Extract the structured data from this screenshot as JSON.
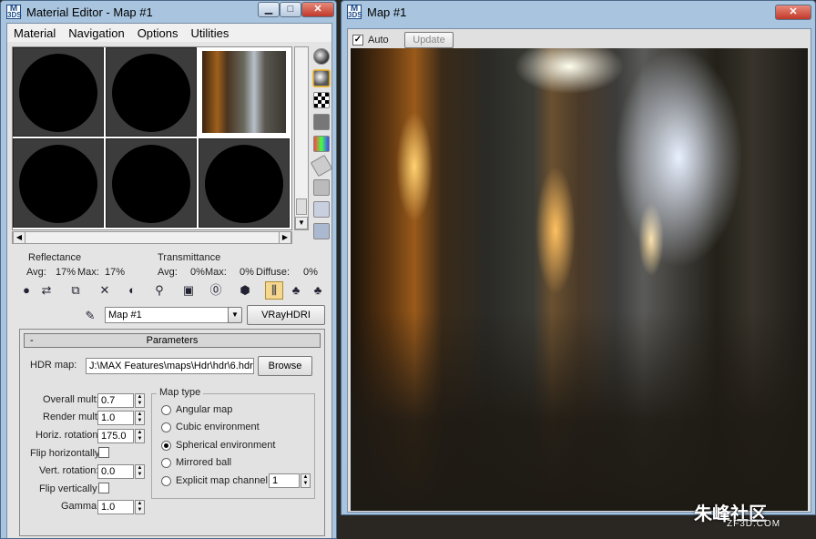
{
  "material_editor": {
    "title": "Material Editor - Map #1",
    "app_icon_text": "3DS",
    "menu": [
      "Material",
      "Navigation",
      "Options",
      "Utilities"
    ],
    "reflectance": {
      "label": "Reflectance",
      "avg": "Avg:",
      "avg_value": "17%",
      "max": "Max:",
      "max_value": "17%"
    },
    "transmittance": {
      "label": "Transmittance",
      "avg": "Avg:",
      "avg_value": "0%",
      "max": "Max:",
      "max_value": "0%",
      "diffuse": "Diffuse:",
      "diffuse_value": "0%"
    },
    "map_name": "Map #1",
    "map_type_button": "VRayHDRI",
    "rollout": {
      "minus": "-",
      "title": "Parameters"
    },
    "hdr_map_label": "HDR map:",
    "hdr_map_path": "J:\\MAX Features\\maps\\Hdr\\hdr\\6.hdr",
    "browse": "Browse",
    "overall_mult": {
      "label": "Overall mult:",
      "value": "0.7"
    },
    "render_mult": {
      "label": "Render mult:",
      "value": "1.0"
    },
    "horiz_rotation": {
      "label": "Horiz. rotation:",
      "value": "175.0"
    },
    "flip_horizontally": "Flip horizontally",
    "vert_rotation": {
      "label": "Vert. rotation:",
      "value": "0.0"
    },
    "flip_vertically": "Flip vertically",
    "gamma": {
      "label": "Gamma:",
      "value": "1.0"
    },
    "map_type": {
      "title": "Map type",
      "options": [
        "Angular map",
        "Cubic environment",
        "Spherical environment",
        "Mirrored ball",
        "Explicit map channel"
      ],
      "selected": "Spherical environment",
      "channel": "1"
    }
  },
  "map_viewer": {
    "title": "Map #1",
    "auto_label": "Auto",
    "auto_checked": true,
    "update": "Update"
  },
  "watermark": {
    "main": "朱峰社区",
    "sub": "ZF3D.COM"
  }
}
